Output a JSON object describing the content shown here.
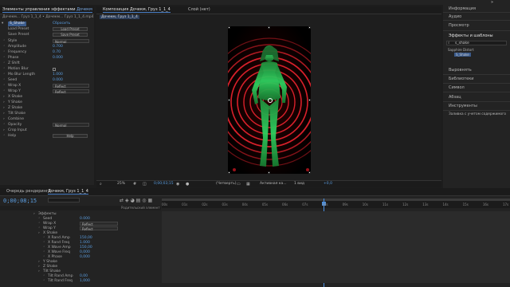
{
  "menubar": {
    "items": [
      "",
      "",
      "",
      "",
      "",
      "",
      "",
      "",
      "",
      "",
      "",
      ""
    ]
  },
  "effect_panel": {
    "tab_label": "Элементы управления эффектами",
    "tab_target": "Дочекм",
    "breadcrumb": "Дочекм... Груз 1_1_4 • Дочекм... Груз 1_1_4.mp4",
    "effect_name": "S_Shake",
    "effect_link": "Сбросить",
    "load_preset_label": "Load Preset",
    "load_preset_btn": "Load Preset",
    "save_preset_label": "Save Preset",
    "save_preset_btn": "Save Preset",
    "props": [
      {
        "label": "Style",
        "type": "drop",
        "value": "Normal"
      },
      {
        "label": "Amplitude",
        "type": "val",
        "value": "0.700"
      },
      {
        "label": "Frequency",
        "type": "val",
        "value": "0.70"
      },
      {
        "label": "Phase",
        "type": "val",
        "value": "0.000"
      },
      {
        "label": "Z Shift",
        "type": "val",
        "value": ""
      },
      {
        "label": "Motion Blur",
        "type": "chk",
        "value": ""
      },
      {
        "label": "Mo Blur Length",
        "type": "val",
        "value": "1.000"
      },
      {
        "label": "Seed",
        "type": "val",
        "value": "0.000"
      },
      {
        "label": "Wrap X",
        "type": "drop",
        "value": "Reflect"
      },
      {
        "label": "Wrap Y",
        "type": "drop",
        "value": "Reflect"
      },
      {
        "label": "X Shake",
        "type": "section",
        "value": ""
      },
      {
        "label": "Y Shake",
        "type": "section",
        "value": ""
      },
      {
        "label": "Z Shake",
        "type": "section",
        "value": ""
      },
      {
        "label": "Tilt Shake",
        "type": "section",
        "value": ""
      },
      {
        "label": "Combine",
        "type": "section",
        "value": ""
      },
      {
        "label": "Opacity",
        "type": "drop",
        "value": "Normal"
      },
      {
        "label": "Crop Input",
        "type": "section",
        "value": ""
      },
      {
        "label": "Help",
        "type": "btn",
        "value": "Help"
      }
    ]
  },
  "comp_panel": {
    "tab_label": "Композиция Дочекм, Груз 1_1_4",
    "tab_subject": "Дочекм, Груз 1_1_4",
    "layer_tab": "Слой (нет)",
    "zoom": "25%",
    "timecode": "0;00;03;15",
    "resolution": "(Четверть)",
    "camera": "Активная ка...",
    "views": "1 вид",
    "exposure": "+0,0"
  },
  "right_panel": {
    "items": [
      "Информация",
      "Аудио",
      "Просмотр",
      "Эффекты и шаблоны",
      "Выровнять",
      "Библиотеки",
      "Символ",
      "Абзац",
      "Инструменты",
      "Заливка с учетом содержимого"
    ],
    "effects_search": "s_shake",
    "effects_tree_1": "Sapphire Distort",
    "effects_tree_2": "S_Shake"
  },
  "timeline": {
    "render_queue_tab": "Очередь рендеринга",
    "comp_tab": "Дочекм, Груз 1_1_4",
    "timecode": "0;00;08;15",
    "mode_header": "Родительский элемент",
    "ruler_labels": [
      "00s",
      "01s",
      "02s",
      "03s",
      "04s",
      "05s",
      "06s",
      "07s",
      "08s",
      "09s",
      "10s",
      "11s",
      "12s",
      "13s",
      "14s",
      "15s",
      "16s",
      "17s"
    ],
    "playhead_fraction": 0.467,
    "rows": [
      {
        "indent": 0,
        "name": "Эффекты",
        "value": "",
        "type": "text"
      },
      {
        "indent": 1,
        "name": "Seed",
        "value": "0.000",
        "type": "val"
      },
      {
        "indent": 1,
        "name": "Wrap X",
        "value": "Reflect",
        "type": "drop"
      },
      {
        "indent": 1,
        "name": "Wrap Y",
        "value": "Reflect",
        "type": "drop"
      },
      {
        "indent": 1,
        "name": "X Shake",
        "value": "",
        "type": "text"
      },
      {
        "indent": 2,
        "name": "X Rand Amp",
        "value": "150,00",
        "type": "val"
      },
      {
        "indent": 2,
        "name": "X Rand Freq",
        "value": "1.000",
        "type": "val"
      },
      {
        "indent": 2,
        "name": "X Wave Amp",
        "value": "150,00",
        "type": "val"
      },
      {
        "indent": 2,
        "name": "X Wave Freq",
        "value": "0,000",
        "type": "val"
      },
      {
        "indent": 2,
        "name": "X Phase",
        "value": "0,000",
        "type": "val"
      },
      {
        "indent": 1,
        "name": "Y Shake",
        "value": "",
        "type": "text"
      },
      {
        "indent": 1,
        "name": "Z Shake",
        "value": "",
        "type": "text"
      },
      {
        "indent": 1,
        "name": "Tilt Shake",
        "value": "",
        "type": "text"
      },
      {
        "indent": 2,
        "name": "Tilt Rand Amp",
        "value": "0,00",
        "type": "val"
      },
      {
        "indent": 2,
        "name": "Tilt Rand Freq",
        "value": "1,000",
        "type": "val"
      }
    ]
  },
  "colors": {
    "accent": "#4a80c8",
    "value_blue": "#5a9de0",
    "playhead": "#4a90e2",
    "ring_red": "#d8202a",
    "figure_green": "#2fd060"
  }
}
